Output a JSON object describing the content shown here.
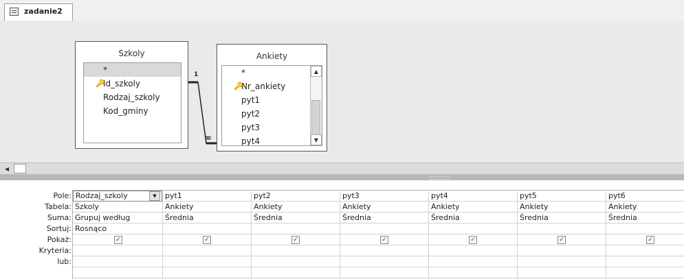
{
  "tab": {
    "label": "zadanie2",
    "icon": "query-table-icon"
  },
  "tables": [
    {
      "title": "Szkoly",
      "fields": [
        "*",
        "Id_szkoly",
        "Rodzaj_szkoly",
        "Kod_gminy"
      ],
      "key_field": "Id_szkoly"
    },
    {
      "title": "Ankiety",
      "fields": [
        "*",
        "Nr_ankiety",
        "pyt1",
        "pyt2",
        "pyt3",
        "pyt4"
      ],
      "key_field": "Nr_ankiety"
    }
  ],
  "relationship": {
    "one_label": "1",
    "many_label": "∞"
  },
  "grid": {
    "row_labels": {
      "field": "Pole:",
      "table": "Tabela:",
      "total": "Suma:",
      "sort": "Sortuj:",
      "show": "Pokaż:",
      "criteria": "Kryteria:",
      "or": "lub:"
    },
    "columns": [
      {
        "field": "Rodzaj_szkoly",
        "table": "Szkoly",
        "total": "Grupuj według",
        "sort": "Rosnąco",
        "show": true
      },
      {
        "field": "pyt1",
        "table": "Ankiety",
        "total": "Średnia",
        "sort": "",
        "show": true
      },
      {
        "field": "pyt2",
        "table": "Ankiety",
        "total": "Średnia",
        "sort": "",
        "show": true
      },
      {
        "field": "pyt3",
        "table": "Ankiety",
        "total": "Średnia",
        "sort": "",
        "show": true
      },
      {
        "field": "pyt4",
        "table": "Ankiety",
        "total": "Średnia",
        "sort": "",
        "show": true
      },
      {
        "field": "pyt5",
        "table": "Ankiety",
        "total": "Średnia",
        "sort": "",
        "show": true
      },
      {
        "field": "pyt6",
        "table": "Ankiety",
        "total": "Średnia",
        "sort": "",
        "show": true
      }
    ]
  },
  "glyphs": {
    "key": "🔑",
    "check": "✓",
    "up": "▲",
    "down": "▼",
    "left": "◀"
  }
}
